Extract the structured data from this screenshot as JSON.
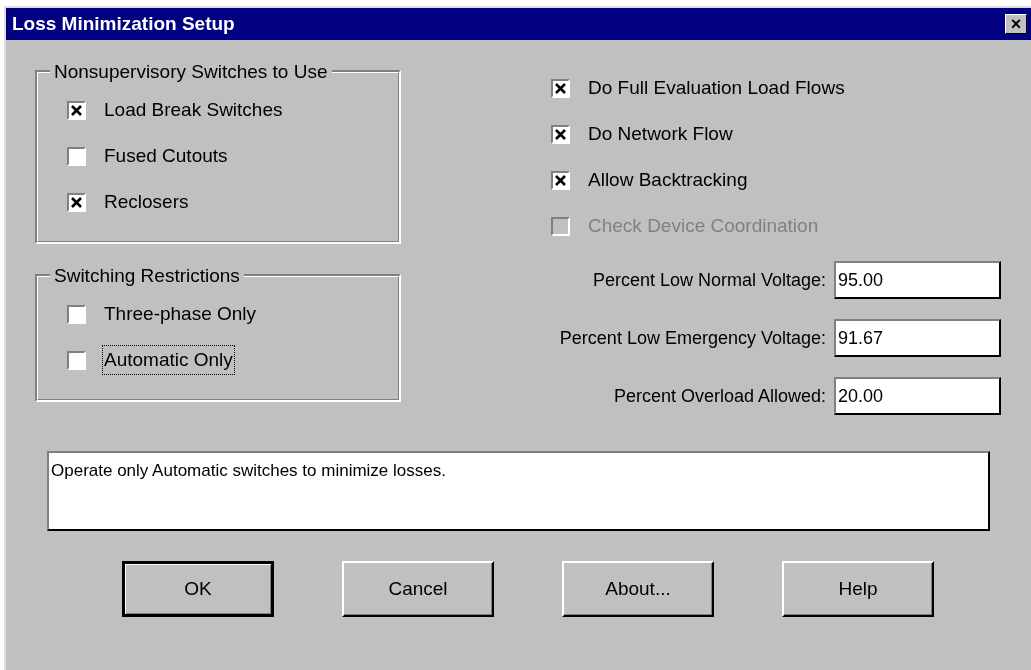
{
  "window": {
    "title": "Loss Minimization Setup",
    "close": "×"
  },
  "groups": [
    {
      "title": "Nonsupervisory Switches to Use",
      "options": [
        {
          "label": "Load Break Switches",
          "checked": true,
          "focused": false
        },
        {
          "label": "Fused Cutouts",
          "checked": false,
          "focused": false
        },
        {
          "label": "Reclosers",
          "checked": true,
          "focused": false
        }
      ]
    },
    {
      "title": "Switching Restrictions",
      "options": [
        {
          "label": "Three-phase Only",
          "checked": false,
          "focused": false
        },
        {
          "label": "Automatic Only",
          "checked": false,
          "focused": true
        }
      ]
    }
  ],
  "options": [
    {
      "label": "Do Full Evaluation Load Flows",
      "checked": true,
      "disabled": false
    },
    {
      "label": "Do Network Flow",
      "checked": true,
      "disabled": false
    },
    {
      "label": "Allow Backtracking",
      "checked": true,
      "disabled": false
    },
    {
      "label": "Check Device Coordination",
      "checked": false,
      "disabled": true
    }
  ],
  "fields": [
    {
      "label": "Percent Low Normal Voltage:",
      "value": "95.00"
    },
    {
      "label": "Percent Low Emergency Voltage:",
      "value": "91.67"
    },
    {
      "label": "Percent Overload Allowed:",
      "value": "20.00"
    }
  ],
  "message": "Operate only Automatic switches to minimize losses.",
  "buttons": [
    {
      "label": "OK",
      "default": true
    },
    {
      "label": "Cancel",
      "default": false
    },
    {
      "label": "About...",
      "default": false
    },
    {
      "label": "Help",
      "default": false
    }
  ]
}
